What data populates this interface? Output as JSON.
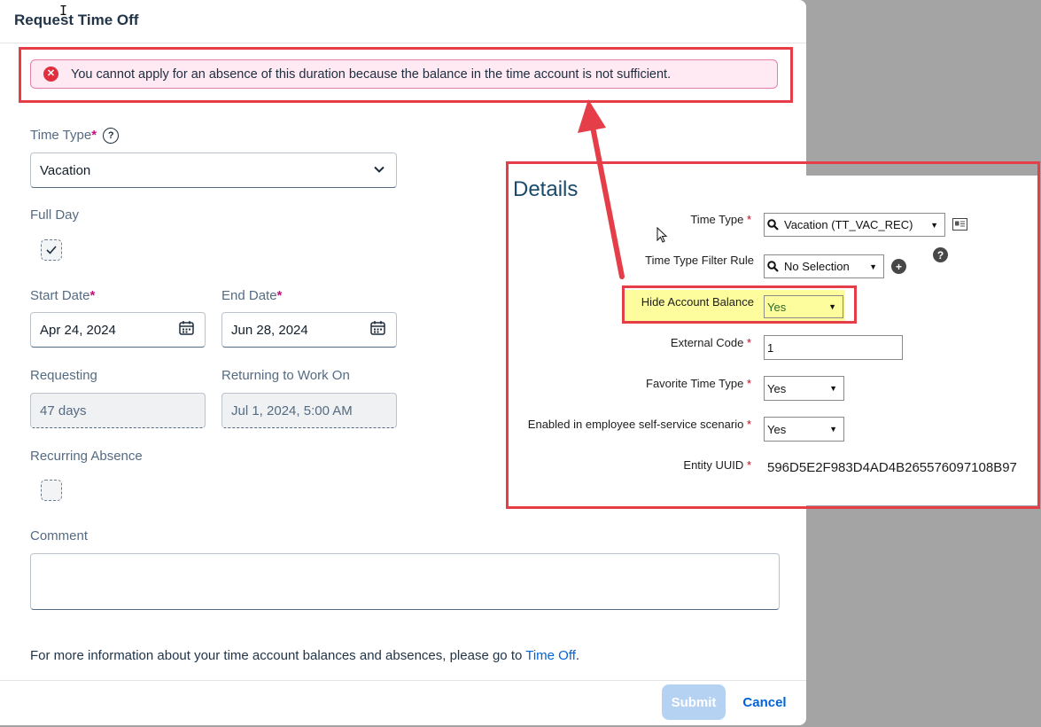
{
  "dialog": {
    "title": "Request Time Off",
    "error_message": "You cannot apply for an absence of this duration because the balance in the time account is not sufficient.",
    "required_mark": "*",
    "time_type": {
      "label": "Time Type",
      "value": "Vacation",
      "help_icon": "question-circle-icon"
    },
    "full_day": {
      "label": "Full Day",
      "checked": true
    },
    "start_date": {
      "label": "Start Date",
      "value": "Apr 24, 2024"
    },
    "end_date": {
      "label": "End Date",
      "value": "Jun 28, 2024"
    },
    "requesting": {
      "label": "Requesting",
      "value": "47 days"
    },
    "returning": {
      "label": "Returning to Work On",
      "value": "Jul 1, 2024, 5:00 AM"
    },
    "recurring": {
      "label": "Recurring Absence",
      "checked": false
    },
    "comment": {
      "label": "Comment",
      "value": ""
    },
    "info": {
      "text": "For more information about your time account balances and absences, please go to ",
      "link": "Time Off",
      "suffix": "."
    },
    "buttons": {
      "submit": "Submit",
      "cancel": "Cancel"
    }
  },
  "details": {
    "title": "Details",
    "required_mark": "*",
    "time_type": {
      "label": "Time Type",
      "value": "Vacation (TT_VAC_REC)"
    },
    "filter_rule": {
      "label": "Time Type Filter Rule",
      "value": "No Selection"
    },
    "hide_balance": {
      "label": "Hide Account Balance",
      "value": "Yes"
    },
    "external_code": {
      "label": "External Code",
      "value": "1"
    },
    "favorite": {
      "label": "Favorite Time Type",
      "value": "Yes"
    },
    "ess": {
      "label": "Enabled in employee self-service scenario",
      "value": "Yes"
    },
    "uuid": {
      "label": "Entity UUID",
      "value": "596D5E2F983D4AD4B265576097108B97"
    }
  },
  "colors": {
    "annotation_red": "#e53e48",
    "highlight_yellow": "#fdfd9d",
    "link_blue": "#0064d9",
    "error_bg": "#ffeaf4"
  }
}
